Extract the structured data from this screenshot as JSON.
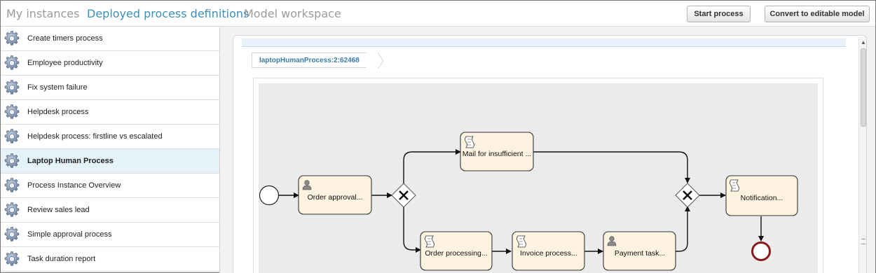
{
  "top_nav": {
    "tabs": [
      {
        "label": "My instances",
        "active": false
      },
      {
        "label": "Deployed process definitions",
        "active": true
      },
      {
        "label": "Model workspace",
        "active": false
      }
    ],
    "buttons": {
      "start_process": "Start process",
      "convert": "Convert to editable model"
    }
  },
  "sidebar": {
    "items": [
      {
        "label": "Create timers process",
        "selected": false
      },
      {
        "label": "Employee productivity",
        "selected": false
      },
      {
        "label": "Fix system failure",
        "selected": false
      },
      {
        "label": "Helpdesk process",
        "selected": false
      },
      {
        "label": "Helpdesk process: firstline vs escalated",
        "selected": false
      },
      {
        "label": "Laptop Human Process",
        "selected": true
      },
      {
        "label": "Process Instance Overview",
        "selected": false
      },
      {
        "label": "Review sales lead",
        "selected": false
      },
      {
        "label": "Simple approval process",
        "selected": false
      },
      {
        "label": "Task duration report",
        "selected": false
      }
    ]
  },
  "breadcrumb": "laptopHumanProcess:2:62468",
  "diagram": {
    "tasks": {
      "order_approval": {
        "label": "Order approval...",
        "kind": "user-task"
      },
      "mail_insufficient": {
        "label": "Mail for insufficient ...",
        "kind": "script-task"
      },
      "order_processing": {
        "label": "Order processing...",
        "kind": "script-task"
      },
      "invoice_process": {
        "label": "Invoice process...",
        "kind": "script-task"
      },
      "payment_task": {
        "label": "Payment task...",
        "kind": "user-task"
      },
      "notification": {
        "label": "Notification...",
        "kind": "script-task"
      }
    },
    "colors": {
      "task_fill": "#fdf3e0",
      "task_stroke": "#333333",
      "end_event": "#8b1a1a",
      "canvas_bg": "#ececec"
    }
  },
  "colors": {
    "accent": "#3b8fb8",
    "selected_row": "#e5f2fa"
  }
}
